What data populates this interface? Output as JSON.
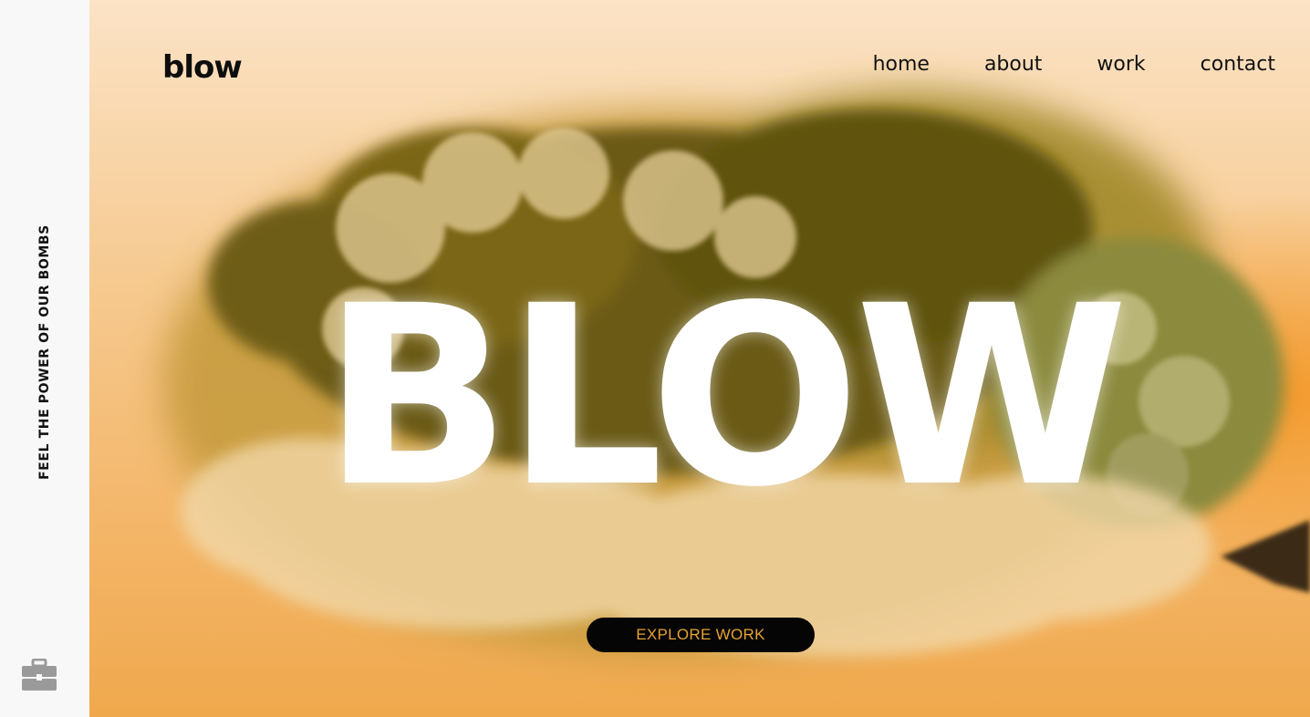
{
  "sidebar": {
    "tagline": "FEEL THE POWER OF OUR BOMBS",
    "icon": "briefcase-icon"
  },
  "header": {
    "logo": "blow",
    "nav": [
      {
        "label": "home"
      },
      {
        "label": "about"
      },
      {
        "label": "work"
      },
      {
        "label": "contact"
      }
    ]
  },
  "hero": {
    "title": "BLOW",
    "cta_label": "EXPLORE WORK"
  },
  "colors": {
    "background": "#f3b567",
    "smoke_dark": "#6b5a12",
    "smoke_light": "#e6cf98",
    "accent": "#e7a22f",
    "button_bg": "#050505"
  }
}
